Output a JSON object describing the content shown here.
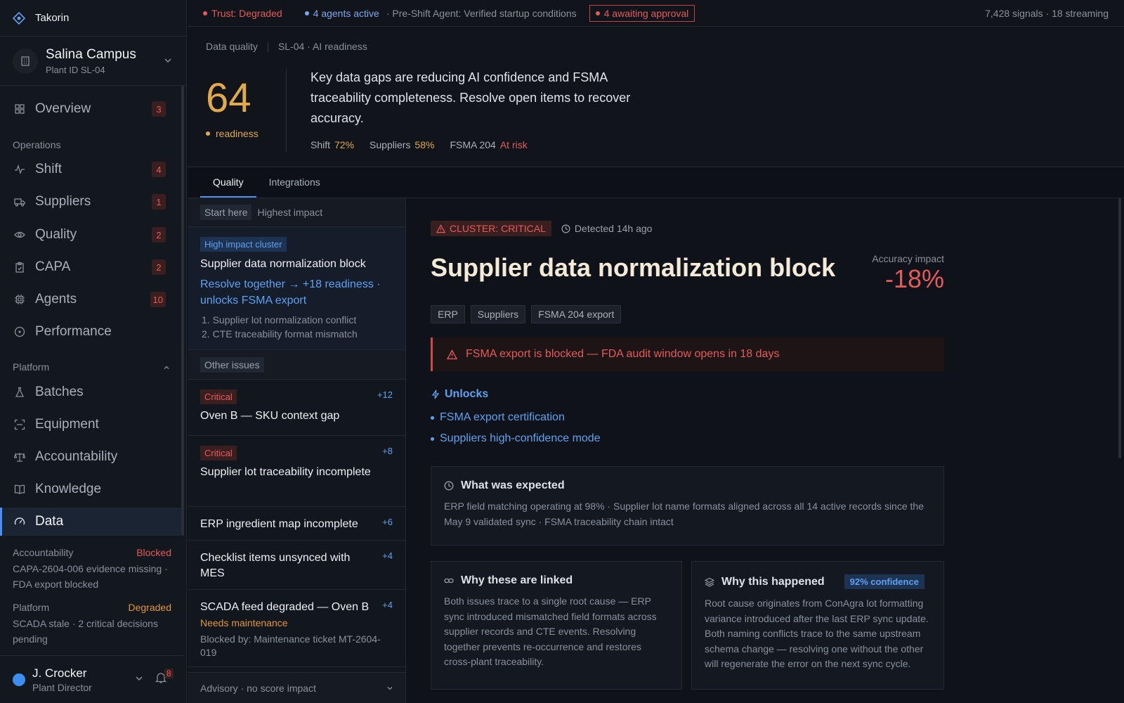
{
  "app": {
    "name": "Takorin"
  },
  "plant": {
    "name": "Salina Campus",
    "id": "Plant ID SL-04"
  },
  "sidebar": {
    "overview": {
      "label": "Overview",
      "badge": "3"
    },
    "sections": {
      "operations": "Operations",
      "platform": "Platform"
    },
    "operations": [
      {
        "label": "Shift",
        "badge": "4"
      },
      {
        "label": "Suppliers",
        "badge": "1"
      },
      {
        "label": "Quality",
        "badge": "2"
      },
      {
        "label": "CAPA",
        "badge": "2"
      },
      {
        "label": "Agents",
        "badge": "10"
      },
      {
        "label": "Performance"
      }
    ],
    "platform": [
      {
        "label": "Batches"
      },
      {
        "label": "Equipment"
      },
      {
        "label": "Accountability"
      },
      {
        "label": "Knowledge"
      },
      {
        "label": "Data"
      }
    ],
    "status": {
      "accountability": {
        "label": "Accountability",
        "value": "Blocked",
        "desc": "CAPA-2604-006 evidence missing · FDA export blocked"
      },
      "platform": {
        "label": "Platform",
        "value": "Degraded",
        "desc": "SCADA stale · 2 critical decisions pending"
      }
    },
    "user": {
      "name": "J. Crocker",
      "role": "Plant Director",
      "notifications": "8"
    }
  },
  "topbar": {
    "trust": "Trust: Degraded",
    "agents": "4 agents active",
    "preshift": "· Pre-Shift Agent: Verified startup conditions",
    "approval": "4 awaiting approval",
    "signals": "7,428 signals · 18 streaming"
  },
  "header": {
    "crumb1": "Data quality",
    "crumb2": "SL-04 · AI readiness",
    "score": "64",
    "score_label": "readiness",
    "summary": "Key data gaps are reducing AI confidence and FSMA traceability completeness. Resolve open items to recover accuracy.",
    "metrics": {
      "shift_label": "Shift",
      "shift_value": "72%",
      "suppliers_label": "Suppliers",
      "suppliers_value": "58%",
      "fsma_label": "FSMA 204",
      "fsma_value": "At risk"
    }
  },
  "tabs": {
    "quality": "Quality",
    "integrations": "Integrations"
  },
  "issues": {
    "start_here": "Start here",
    "highest_impact": "Highest impact",
    "cluster": {
      "chip": "High impact cluster",
      "title": "Supplier data normalization block",
      "link": "Resolve together → +18 readiness · unlocks FSMA export",
      "items": [
        "1.  Supplier lot normalization conflict",
        "2.  CTE traceability format mismatch"
      ]
    },
    "other_issues": "Other issues",
    "list": [
      {
        "tag": "Critical",
        "title": "Oven B — SKU context gap",
        "score": "+12"
      },
      {
        "tag": "Critical",
        "title": "Supplier lot traceability incomplete",
        "score": "+8"
      },
      {
        "title": "ERP ingredient map incomplete",
        "score": "+6"
      },
      {
        "title": "Checklist items unsynced with MES",
        "score": "+4"
      },
      {
        "title": "SCADA feed degraded — Oven B",
        "score": "+4",
        "sub": "Needs maintenance",
        "note": "Blocked by: Maintenance ticket MT-2604-019"
      }
    ],
    "advisory": "Advisory · no score impact"
  },
  "detail": {
    "cluster_chip": "CLUSTER: CRITICAL",
    "detected": "Detected 14h ago",
    "title": "Supplier data normalization block",
    "accuracy_label": "Accuracy impact",
    "accuracy_value": "-18%",
    "tags": [
      "ERP",
      "Suppliers",
      "FSMA 204 export"
    ],
    "alert": "FSMA export is blocked — FDA audit window opens in 18 days",
    "unlocks_title": "Unlocks",
    "unlocks": [
      "FSMA export certification",
      "Suppliers high-confidence mode"
    ],
    "expected": {
      "title": "What was expected",
      "body": "ERP field matching operating at 98% · Supplier lot name formats aligned across all 14 active records since the May 9 validated sync · FSMA traceability chain intact"
    },
    "linked": {
      "title": "Why these are linked",
      "body": "Both issues trace to a single root cause — ERP sync introduced mismatched field formats across supplier records and CTE events. Resolving together prevents re-occurrence and restores cross-plant traceability."
    },
    "why": {
      "title": "Why this happened",
      "confidence": "92% confidence",
      "body": "Root cause originates from ConAgra lot formatting variance introduced after the last ERP sync update. Both naming conflicts trace to the same upstream schema change — resolving one without the other will regenerate the error on the next sync cycle."
    }
  },
  "colors": {
    "accent": "#4c8ff0",
    "critical": "#e55a5a",
    "warning": "#e0a94a",
    "info": "#5ea1f2"
  }
}
